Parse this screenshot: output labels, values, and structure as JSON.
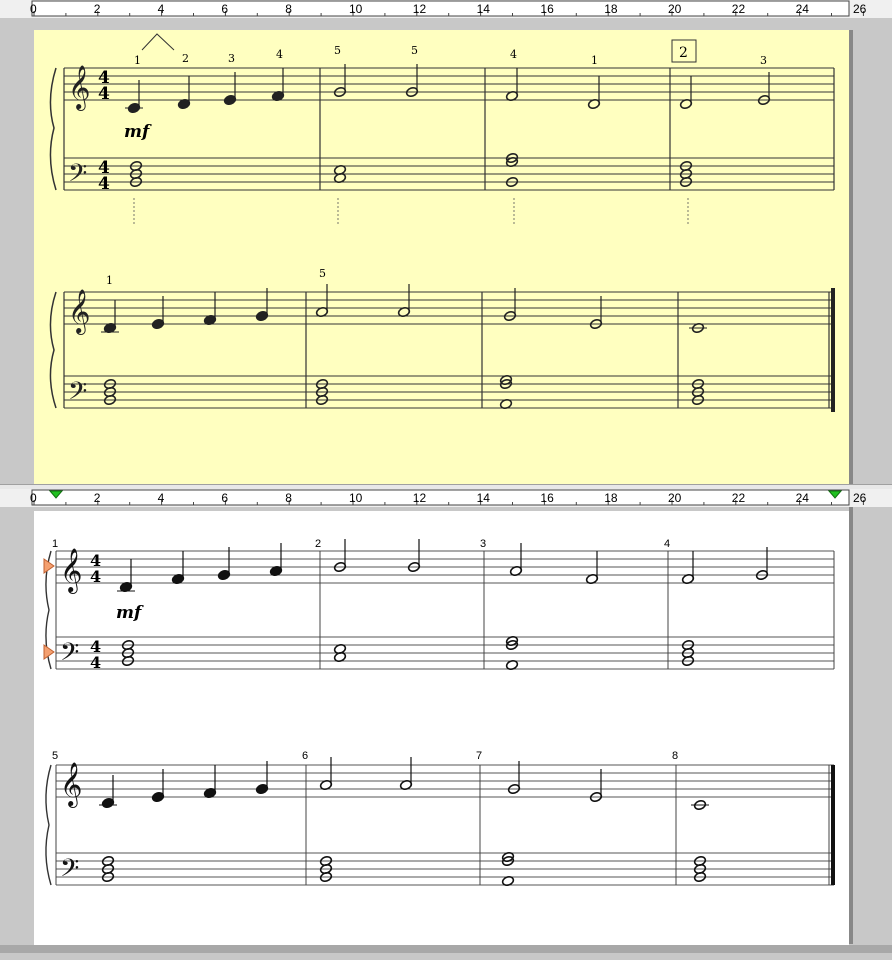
{
  "app": {
    "panes": [
      {
        "name": "scanned-original",
        "ruler": {
          "labels": [
            "0",
            "2",
            "4",
            "6",
            "8",
            "10",
            "12",
            "14",
            "16",
            "18",
            "20",
            "22",
            "24",
            "26"
          ]
        },
        "fingerings_top_line1": [
          "1",
          "2",
          "3",
          "4",
          "5",
          "5",
          "4",
          "1",
          "3"
        ],
        "rehearsal_box": "2",
        "dynamic": "mf",
        "time_signature": {
          "upper": "4",
          "lower": "4"
        },
        "fingering_line2": "1",
        "fingering_line2_b": "5"
      },
      {
        "name": "rendered-score",
        "ruler": {
          "labels": [
            "0",
            "2",
            "4",
            "6",
            "8",
            "10",
            "12",
            "14",
            "16",
            "18",
            "20",
            "22",
            "24",
            "26"
          ]
        },
        "measure_numbers": [
          "1",
          "2",
          "3",
          "4",
          "5",
          "6",
          "7",
          "8"
        ],
        "dynamic": "mf",
        "time_signature": {
          "upper": "4",
          "lower": "4"
        }
      }
    ],
    "colors": {
      "scan_bg": "#ffffc0",
      "score_bg": "#ffffff",
      "marker_orange": "#f4a070",
      "marker_green": "#20a020"
    }
  }
}
